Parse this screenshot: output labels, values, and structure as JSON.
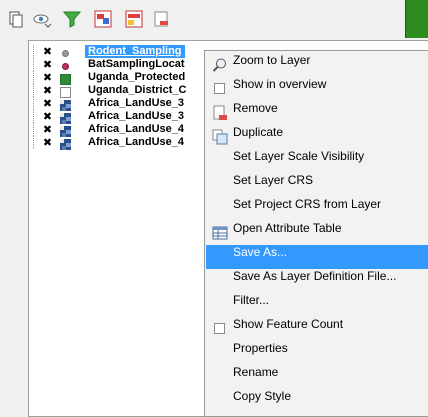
{
  "toolbar": {
    "buttons": [
      {
        "icon": "layer-options-icon"
      },
      {
        "icon": "manage-visibility-icon"
      },
      {
        "icon": "filter-legend-icon"
      },
      {
        "icon": "expand-all-icon"
      },
      {
        "icon": "collapse-all-icon"
      },
      {
        "icon": "remove-layer-icon"
      }
    ],
    "accent_color": "#2e8b20"
  },
  "layers": [
    {
      "label": "Rodent_Sampling",
      "checked": true,
      "symbol": "point-grey",
      "selected": true
    },
    {
      "label": "BatSamplingLocat",
      "checked": true,
      "symbol": "point-red",
      "selected": false
    },
    {
      "label": "Uganda_Protected",
      "checked": true,
      "symbol": "fill-green",
      "selected": false
    },
    {
      "label": "Uganda_District_C",
      "checked": true,
      "symbol": "fill-white",
      "selected": false
    },
    {
      "label": "Africa_LandUse_3",
      "checked": true,
      "symbol": "raster",
      "selected": false
    },
    {
      "label": "Africa_LandUse_3",
      "checked": true,
      "symbol": "raster",
      "selected": false
    },
    {
      "label": "Africa_LandUse_4",
      "checked": true,
      "symbol": "raster",
      "selected": false
    },
    {
      "label": "Africa_LandUse_4",
      "checked": true,
      "symbol": "raster",
      "selected": false
    }
  ],
  "context_menu": {
    "items": [
      {
        "label": "Zoom to Layer",
        "icon": "zoom-icon"
      },
      {
        "label": "Show in overview",
        "icon": "checkbox"
      },
      {
        "label": "Remove",
        "icon": "remove-icon"
      },
      {
        "label": "Duplicate",
        "icon": "duplicate-icon"
      },
      {
        "label": "Set Layer Scale Visibility",
        "icon": ""
      },
      {
        "label": "Set Layer CRS",
        "icon": ""
      },
      {
        "label": "Set Project CRS from Layer",
        "icon": ""
      },
      {
        "label": "Open Attribute Table",
        "icon": "table-icon"
      },
      {
        "label": "Save As...",
        "icon": "",
        "highlighted": true
      },
      {
        "label": "Save As Layer Definition File...",
        "icon": ""
      },
      {
        "label": "Filter...",
        "icon": ""
      },
      {
        "label": "Show Feature Count",
        "icon": "checkbox"
      },
      {
        "label": "Properties",
        "icon": ""
      },
      {
        "label": "Rename",
        "icon": ""
      },
      {
        "label": "Copy Style",
        "icon": ""
      }
    ],
    "highlight_color": "#3399ff"
  }
}
